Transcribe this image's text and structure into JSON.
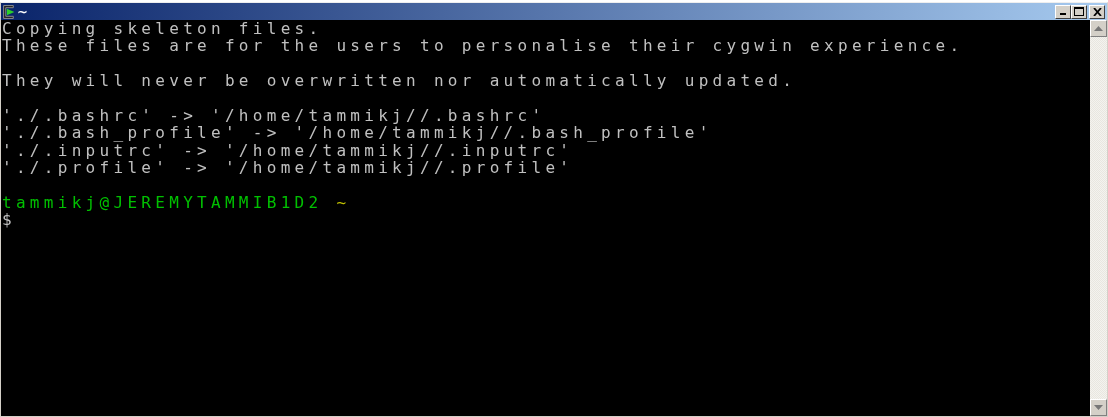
{
  "window": {
    "title": "~"
  },
  "terminal": {
    "lines": [
      {
        "kind": "output",
        "text": "Copying skeleton files."
      },
      {
        "kind": "output",
        "text": "These files are for the users to personalise their cygwin experience."
      },
      {
        "kind": "blank"
      },
      {
        "kind": "output",
        "text": "They will never be overwritten nor automatically updated."
      },
      {
        "kind": "blank"
      },
      {
        "kind": "output",
        "text": "'./.bashrc' -> '/home/tammikj//.bashrc'"
      },
      {
        "kind": "output",
        "text": "'./.bash_profile' -> '/home/tammikj//.bash_profile'"
      },
      {
        "kind": "output",
        "text": "'./.inputrc' -> '/home/tammikj//.inputrc'"
      },
      {
        "kind": "output",
        "text": "'./.profile' -> '/home/tammikj//.profile'"
      },
      {
        "kind": "blank"
      },
      {
        "kind": "prompt",
        "user_host": "tammikj@JEREMYTAMMIB1D2",
        "path": "~"
      },
      {
        "kind": "input",
        "symbol": "$"
      }
    ]
  }
}
